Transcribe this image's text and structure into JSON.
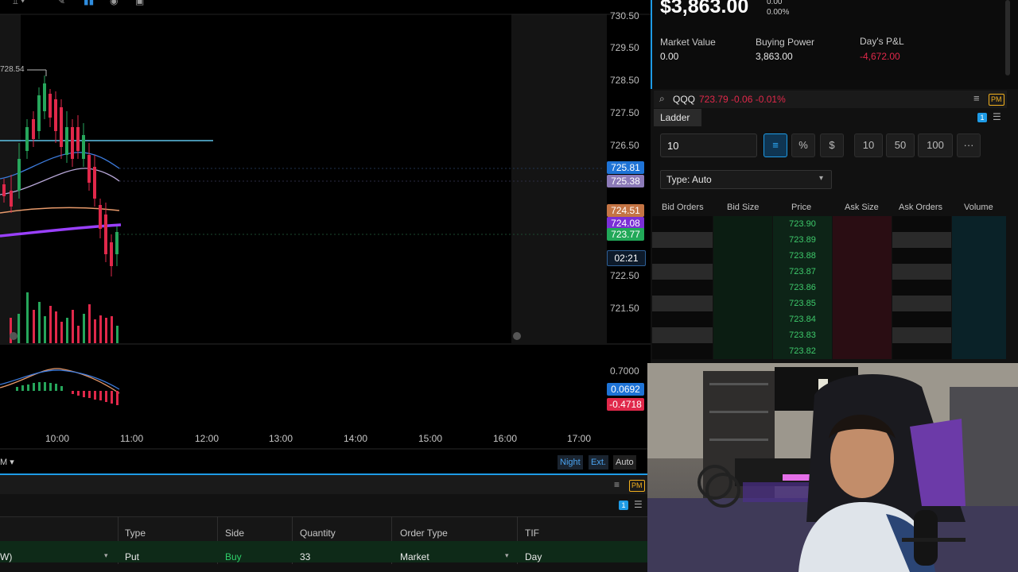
{
  "chart": {
    "y_axis": [
      "730.50",
      "729.50",
      "728.50",
      "727.50",
      "726.50",
      "722.50",
      "721.50"
    ],
    "high_marker": "728.54",
    "tags": {
      "ema_a": "725.81",
      "ema_b": "725.38",
      "ema_c": "724.51",
      "ema_d": "724.08",
      "last": "723.77",
      "countdown": "02:21"
    },
    "macd_axis": "0.7000",
    "macd_tags": {
      "signal": "0.0692",
      "hist": "-0.4718"
    },
    "x_axis": [
      "10:00",
      "11:00",
      "12:00",
      "13:00",
      "14:00",
      "15:00",
      "16:00",
      "17:00"
    ],
    "timeframe": "M",
    "session_buttons": [
      "Night",
      "Ext.",
      "Auto"
    ]
  },
  "account": {
    "balance": "$3,863.00",
    "change": "0.00",
    "change_pct": "0.00%",
    "market_value_label": "Market Value",
    "market_value": "0.00",
    "buying_power_label": "Buying Power",
    "buying_power": "3,863.00",
    "days_pl_label": "Day's P&L",
    "days_pl": "-4,672.00"
  },
  "ladder": {
    "symbol": "QQQ",
    "quote": "723.79 -0.06 -0.01%",
    "pm_badge": "PM",
    "tab": "Ladder",
    "tab_badge": "1",
    "quantity": "10",
    "qty_presets": [
      "10",
      "50",
      "100"
    ],
    "more": "···",
    "type_select": "Type: Auto",
    "columns": [
      "Bid Orders",
      "Bid Size",
      "Price",
      "Ask Size",
      "Ask Orders",
      "Volume"
    ],
    "prices": [
      "723.90",
      "723.89",
      "723.88",
      "723.87",
      "723.86",
      "723.85",
      "723.84",
      "723.83",
      "723.82"
    ]
  },
  "order": {
    "pm_badge": "PM",
    "badge": "1",
    "headers": [
      "Type",
      "Side",
      "Quantity",
      "Order Type",
      "TIF"
    ],
    "symbol_tail": "W)",
    "values": {
      "type": "Put",
      "side": "Buy",
      "quantity": "33",
      "order_type": "Market",
      "tif": "Day"
    }
  },
  "colors": {
    "up": "#26a65b",
    "down": "#e0284a",
    "ema_blue": "#3d7de0",
    "ema_orange": "#e89a6b",
    "purple": "#9a40ff",
    "accent": "#1e9be6"
  }
}
